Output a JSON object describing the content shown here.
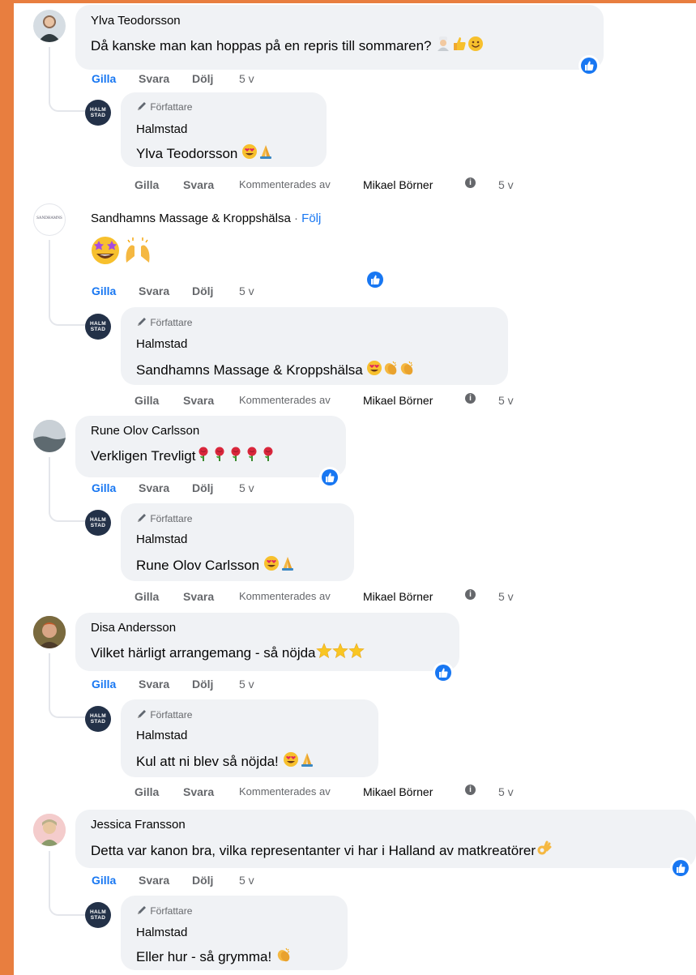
{
  "threads": [
    {
      "author": "Ylva Teodorsson",
      "text": "Då kanske man kan hoppas på en repris till sommaren?",
      "like": "Gilla",
      "reply": "Svara",
      "hide": "Dölj",
      "time": "5 v",
      "reply_post": {
        "badge": "Författare",
        "author": "Halmstad",
        "text": "Ylva Teodorsson",
        "like": "Gilla",
        "reply": "Svara",
        "commented_by_prefix": "Kommenterades av",
        "commented_by": "Mikael Börner",
        "time": "5 v"
      }
    },
    {
      "author": "Sandhamns Massage & Kroppshälsa",
      "follow_sep": " · ",
      "follow": "Följ",
      "text": "",
      "like": "Gilla",
      "reply": "Svara",
      "hide": "Dölj",
      "time": "5 v",
      "avatar_logo": "SANDHAMNS",
      "reply_post": {
        "badge": "Författare",
        "author": "Halmstad",
        "text": "Sandhamns Massage & Kroppshälsa",
        "like": "Gilla",
        "reply": "Svara",
        "commented_by_prefix": "Kommenterades av",
        "commented_by": "Mikael Börner",
        "time": "5 v"
      }
    },
    {
      "author": "Rune Olov Carlsson",
      "text": "Verkligen Trevligt",
      "like": "Gilla",
      "reply": "Svara",
      "hide": "Dölj",
      "time": "5 v",
      "reply_post": {
        "badge": "Författare",
        "author": "Halmstad",
        "text": "Rune Olov Carlsson",
        "like": "Gilla",
        "reply": "Svara",
        "commented_by_prefix": "Kommenterades av",
        "commented_by": "Mikael Börner",
        "time": "5 v"
      }
    },
    {
      "author": "Disa Andersson",
      "text": "Vilket härligt arrangemang - så nöjda",
      "like": "Gilla",
      "reply": "Svara",
      "hide": "Dölj",
      "time": "5 v",
      "reply_post": {
        "badge": "Författare",
        "author": "Halmstad",
        "text": "Kul att ni blev så nöjda!",
        "like": "Gilla",
        "reply": "Svara",
        "commented_by_prefix": "Kommenterades av",
        "commented_by": "Mikael Börner",
        "time": "5 v"
      }
    },
    {
      "author": "Jessica Fransson",
      "text": "Detta var kanon bra, vilka representanter vi har i Halland av matkreatörer",
      "like": "Gilla",
      "reply": "Svara",
      "hide": "Dölj",
      "time": "5 v",
      "reply_post": {
        "badge": "Författare",
        "author": "Halmstad",
        "text": "Eller hur - så grymma!"
      }
    }
  ],
  "page_avatar_label": "HALM STAD",
  "icons": [
    "like-reaction-icon",
    "pen-icon",
    "info-icon",
    "heart-eyes-emoji",
    "pray-emoji",
    "rose-emoji",
    "star-emoji",
    "clap-emoji",
    "ok-hand-emoji",
    "thumbs-up-emoji",
    "smile-emoji",
    "star-struck-emoji",
    "raising-hands-emoji",
    "cook-emoji"
  ],
  "colors": {
    "accent": "#1877f2",
    "background": "#e87e3f",
    "bubble": "#f0f2f5",
    "secondary_text": "#65676b",
    "page_avatar": "#233148"
  }
}
